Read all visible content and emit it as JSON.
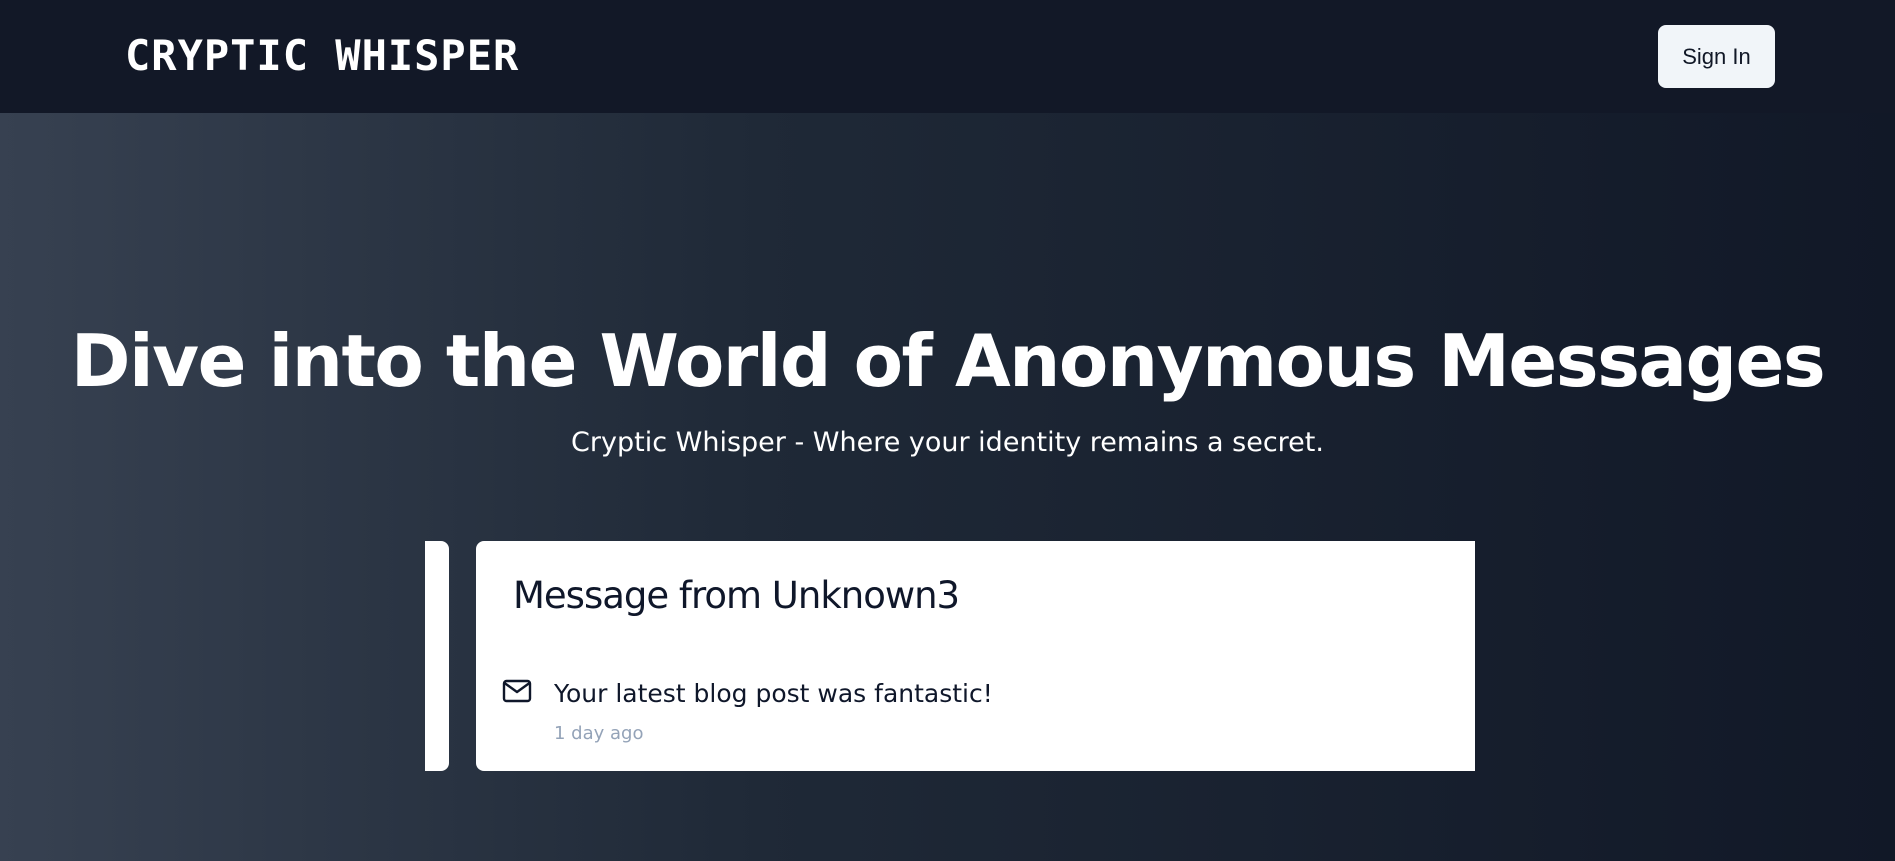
{
  "header": {
    "brand": "Cryptic Whisper",
    "sign_in_label": "Sign In"
  },
  "hero": {
    "title": "Dive into the World of Anonymous Messages",
    "subtitle": "Cryptic Whisper - Where your identity remains a secret."
  },
  "carousel": {
    "current": {
      "title": "Message from Unknown3",
      "icon": "mail-icon",
      "message": "Your latest blog post was fantastic!",
      "time": "1 day ago"
    }
  },
  "colors": {
    "nav_background": "#121827",
    "hero_gradient_start": "#374151",
    "hero_gradient_end": "#111827",
    "button_background": "#f1f5f9",
    "muted_text": "#94a3b8"
  }
}
